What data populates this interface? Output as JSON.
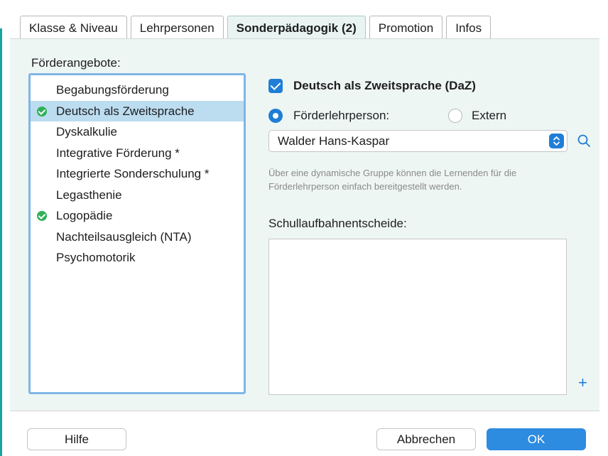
{
  "tabs": [
    {
      "label": "Klasse & Niveau"
    },
    {
      "label": "Lehrpersonen"
    },
    {
      "label": "Sonderpädagogik (2)",
      "active": true
    },
    {
      "label": "Promotion"
    },
    {
      "label": "Infos"
    }
  ],
  "left": {
    "title": "Förderangebote:",
    "items": [
      {
        "label": "Begabungsförderung",
        "checked": false
      },
      {
        "label": "Deutsch als Zweitsprache",
        "checked": true,
        "selected": true
      },
      {
        "label": "Dyskalkulie",
        "checked": false
      },
      {
        "label": "Integrative Förderung *",
        "checked": false
      },
      {
        "label": "Integrierte Sonderschulung *",
        "checked": false
      },
      {
        "label": "Legasthenie",
        "checked": false
      },
      {
        "label": "Logopädie",
        "checked": true
      },
      {
        "label": "Nachteilsausgleich (NTA)",
        "checked": false
      },
      {
        "label": "Psychomotorik",
        "checked": false
      }
    ]
  },
  "right": {
    "checkbox_label": "Deutsch als Zweitsprache (DaZ)",
    "radio_teacher_label": "Förderlehrperson:",
    "radio_extern_label": "Extern",
    "select_value": "Walder Hans-Kaspar",
    "hint_line1": "Über eine dynamische Gruppe können die Lernenden für die",
    "hint_line2": "Förderlehrperson einfach bereitgestellt werden.",
    "decisions_label": "Schullaufbahnentscheide:",
    "plus_label": "+"
  },
  "footer": {
    "help_label": "Hilfe",
    "cancel_label": "Abbrechen",
    "ok_label": "OK"
  },
  "colors": {
    "accent": "#1f7ed6",
    "selection": "#bcdcf0",
    "check_green": "#2fb158",
    "panel": "#eef6f4"
  }
}
